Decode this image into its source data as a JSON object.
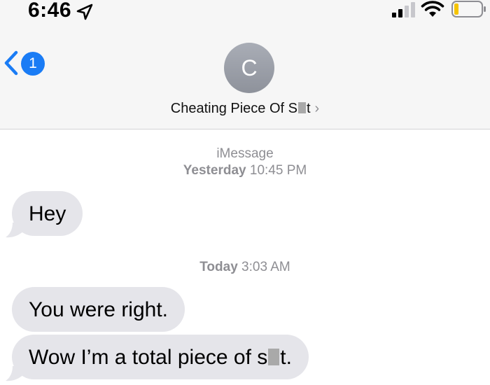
{
  "status_bar": {
    "time": "6:46",
    "location_icon": "location-arrow-icon",
    "signal_icon": "cellular-signal-icon",
    "wifi_icon": "wifi-icon",
    "battery_icon": "battery-low-icon"
  },
  "nav": {
    "back_badge_count": "1",
    "back_icon": "chevron-left-icon",
    "avatar_initial": "C",
    "contact_name_prefix": "Cheating Piece Of S",
    "contact_name_suffix": "t",
    "contact_chevron": "›"
  },
  "messages": {
    "service_label": "iMessage",
    "timestamp_1": {
      "day": "Yesterday",
      "time": "10:45 PM"
    },
    "bubble_1": "Hey",
    "timestamp_2": {
      "day": "Today",
      "time": "3:03 AM"
    },
    "bubble_2": "You were right.",
    "bubble_3_prefix": "Wow I’m a total piece of s",
    "bubble_3_suffix": "t."
  },
  "colors": {
    "header_bg": "#f6f6f6",
    "accent_blue": "#1a7cf5",
    "bubble_gray": "#e5e5ea",
    "timestamp_gray": "#8e8e93",
    "battery_yellow": "#f5c400"
  }
}
